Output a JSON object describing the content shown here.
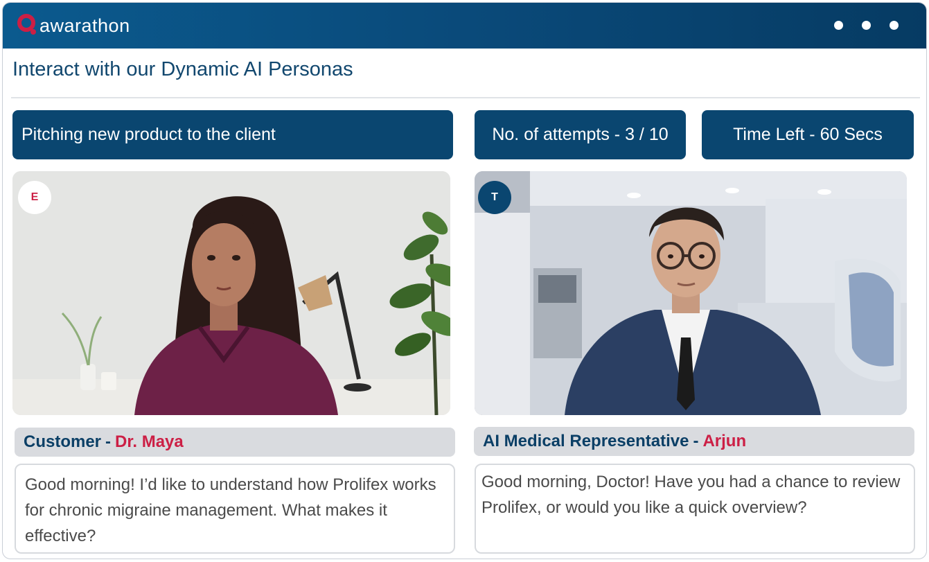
{
  "app": {
    "brand_name": "awarathon",
    "brand_color": "#cc1f45",
    "header_color": "#0a4a7a"
  },
  "header": {
    "menu_icon": "more-dots-icon"
  },
  "page": {
    "title": "Interact with our Dynamic AI Personas"
  },
  "session": {
    "scenario": "Pitching new product to the client",
    "attempts_label": "No. of attempts - 3 / 10",
    "time_left_label": "Time Left - 60 Secs"
  },
  "participants": {
    "left": {
      "badge": "E",
      "role": "Customer",
      "separator": "-",
      "name": "Dr. Maya",
      "message": "Good morning! I’d like to understand how Prolifex works for chronic migraine management. What makes it effective?"
    },
    "right": {
      "badge": "T",
      "role": "AI Medical Representative",
      "separator": "-",
      "name": "Arjun",
      "message": "Good morning, Doctor! Have you had a chance to review Prolifex, or would you like a quick overview?"
    }
  }
}
